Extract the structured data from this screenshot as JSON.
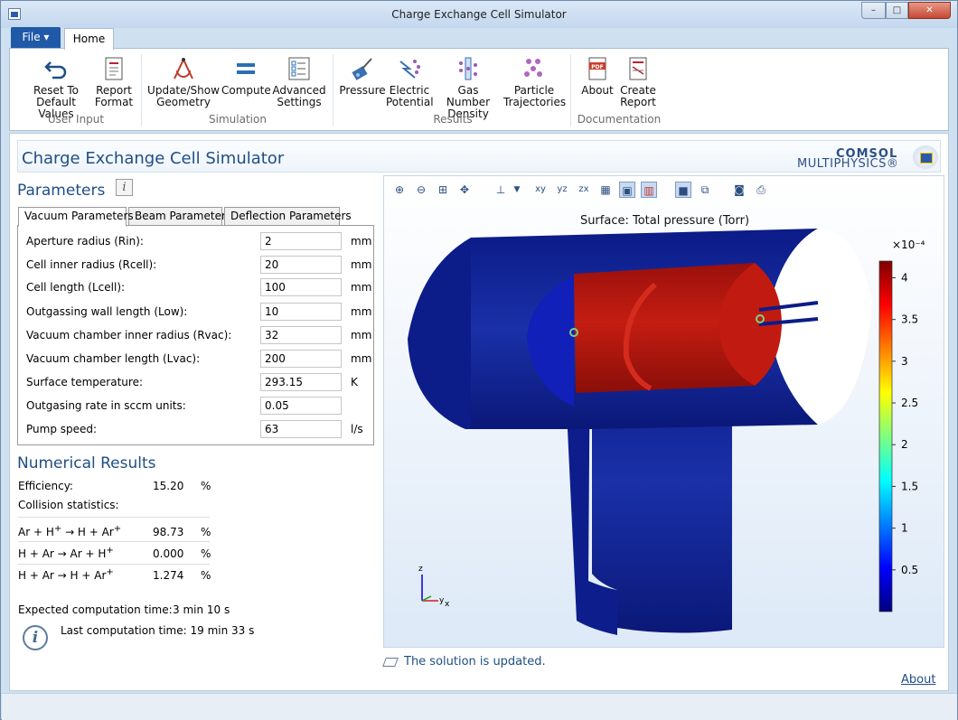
{
  "window": {
    "title": "Charge Exchange Cell Simulator",
    "min": "–",
    "max": "□",
    "close": "✕"
  },
  "ribbon_tabs": {
    "file": "File ▾",
    "home": "Home"
  },
  "ribbon": {
    "reset": [
      "Reset To",
      "Default Values"
    ],
    "report_format": [
      "Report",
      "Format"
    ],
    "update_geometry": [
      "Update/Show",
      "Geometry"
    ],
    "compute": "Compute",
    "advanced": [
      "Advanced",
      "Settings"
    ],
    "pressure": "Pressure",
    "electric": [
      "Electric",
      "Potential"
    ],
    "gas": [
      "Gas Number",
      "Density"
    ],
    "particle": [
      "Particle",
      "Trajectories"
    ],
    "about": "About",
    "create_report": [
      "Create",
      "Report"
    ],
    "groups": {
      "user_input": "User Input",
      "simulation": "Simulation",
      "results": "Results",
      "documentation": "Documentation"
    }
  },
  "header": {
    "title": "Charge Exchange Cell Simulator",
    "logo_line1": "COMSOL",
    "logo_line2": "MULTIPHYSICS®"
  },
  "parameters": {
    "heading": "Parameters",
    "info": "i",
    "tabs": [
      "Vacuum Parameters",
      "Beam Parameters",
      "Deflection Parameters"
    ],
    "rows": [
      {
        "label": "Aperture radius (Rin):",
        "value": "2",
        "unit": "mm"
      },
      {
        "label": "Cell inner radius (Rcell):",
        "value": "20",
        "unit": "mm"
      },
      {
        "label": "Cell length (Lcell):",
        "value": "100",
        "unit": "mm"
      },
      {
        "label": "Outgassing wall length (Low):",
        "value": "10",
        "unit": "mm"
      },
      {
        "label": "Vacuum chamber inner radius (Rvac):",
        "value": "32",
        "unit": "mm"
      },
      {
        "label": "Vacuum chamber length (Lvac):",
        "value": "200",
        "unit": "mm"
      },
      {
        "label": "Surface temperature:",
        "value": "293.15",
        "unit": "K"
      },
      {
        "label": "Outgasing rate in sccm units:",
        "value": "0.05",
        "unit": ""
      },
      {
        "label": "Pump speed:",
        "value": "63",
        "unit": "l/s"
      }
    ]
  },
  "results": {
    "heading": "Numerical Results",
    "efficiency_label": "Efficiency:",
    "efficiency_value": "15.20",
    "efficiency_unit": "%",
    "collision_label": "Collision statistics:",
    "reactions": [
      {
        "value": "98.73",
        "unit": "%"
      },
      {
        "value": "0.000",
        "unit": "%"
      },
      {
        "value": "1.274",
        "unit": "%"
      }
    ],
    "expected_label": "Expected computation time:",
    "expected_value": "3 min 10 s",
    "last": "Last computation time: 19 min 33 s"
  },
  "graphics": {
    "title": "Surface: Total pressure (Torr)",
    "colorbar_exponent": "×10⁻⁴",
    "colorbar_ticks": [
      "4",
      "3.5",
      "3",
      "2.5",
      "2",
      "1.5",
      "1",
      "0.5"
    ],
    "axes": {
      "z": "z",
      "y": "y",
      "x": "x"
    }
  },
  "status": "The solution is updated.",
  "about_link": "About",
  "colors": {
    "accent": "#1f4e85",
    "file_tab": "#1f59a8",
    "geometry": "#0d1e8c",
    "cell": "#b0140e"
  }
}
